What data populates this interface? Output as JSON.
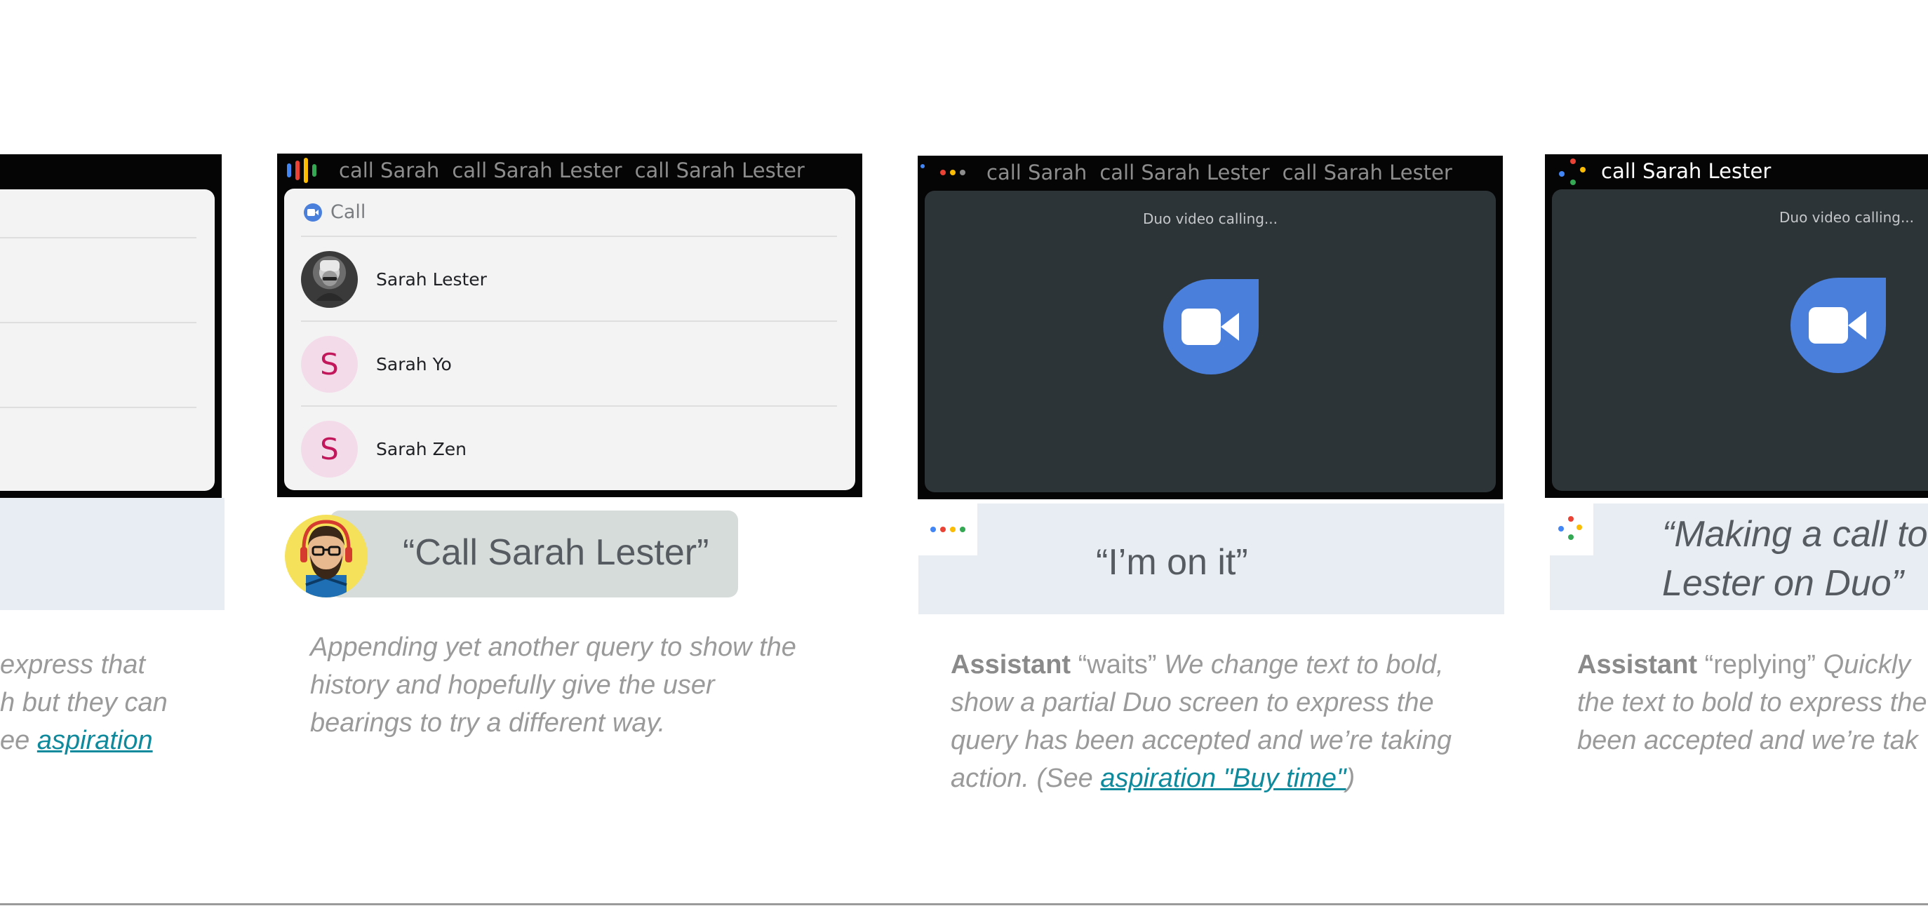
{
  "colors": {
    "link": "#0f8a9d",
    "duo_blue": "#4a7fdc",
    "response_bg": "#e8edf4",
    "user_bubble": "#d6dcda"
  },
  "panel1": {
    "caption_lines": [
      "express that",
      "h but they can",
      "ee "
    ],
    "caption_link": "aspiration"
  },
  "panel2": {
    "queries": [
      "call Sarah",
      "call Sarah Lester",
      "call Sarah Lester"
    ],
    "card_header": "Call",
    "contacts": [
      {
        "initial": "",
        "name": "Sarah Lester"
      },
      {
        "initial": "S",
        "name": "Sarah Yo"
      },
      {
        "initial": "S",
        "name": "Sarah Zen"
      }
    ],
    "user_utterance": "“Call Sarah Lester”",
    "caption_lines": [
      "Appending yet another query to show the",
      "history and hopefully give the user",
      "bearings to try a different way."
    ]
  },
  "panel3": {
    "queries": [
      "call Sarah",
      "call Sarah Lester",
      "call Sarah Lester"
    ],
    "duo_label": "Duo video calling...",
    "response": "“I’m on it”",
    "caption_bold": "Assistant",
    "caption_quote": " “waits” ",
    "caption_line1_rest": "We change text to bold,",
    "caption_line2": "show a partial Duo screen to express the",
    "caption_line3": "query has been accepted and we’re taking",
    "caption_line4_pre": "action. (See ",
    "caption_link": "aspiration \"Buy time\"",
    "caption_line4_post": ")"
  },
  "panel4": {
    "query": "call Sarah Lester",
    "duo_label": "Duo video calling...",
    "response_line1": "“Making a call to",
    "response_line2": "Lester on Duo”",
    "caption_bold": "Assistant",
    "caption_quote": " “replying” ",
    "caption_line1_rest": "Quickly",
    "caption_line2": "the text to bold to express the",
    "caption_line3": "been accepted and we’re tak"
  }
}
